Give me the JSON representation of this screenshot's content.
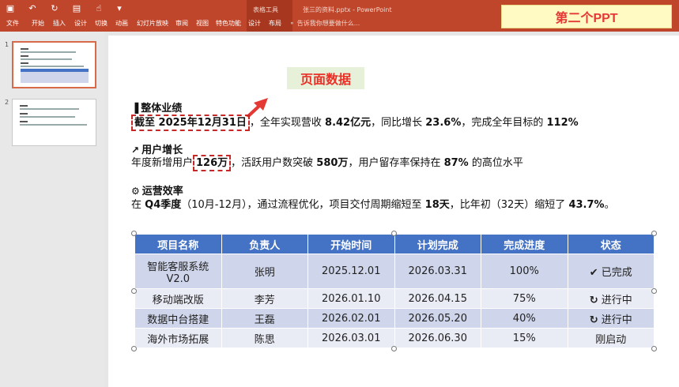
{
  "ribbon": {
    "quick_access": [
      {
        "icon": "save-icon",
        "glyph": "▣"
      },
      {
        "icon": "undo-icon",
        "glyph": "↶"
      },
      {
        "icon": "redo-icon",
        "glyph": "↻"
      },
      {
        "icon": "presentation-icon",
        "glyph": "▤"
      },
      {
        "icon": "touch-mode-icon",
        "glyph": "☝"
      },
      {
        "icon": "customize-icon",
        "glyph": "▾"
      }
    ],
    "tabs": [
      "文件",
      "开始",
      "插入",
      "设计",
      "切换",
      "动画",
      "幻灯片放映",
      "审阅",
      "视图",
      "特色功能",
      "设计",
      "布局"
    ],
    "context_group": "表格工具",
    "document_title": "张三的资料.pptx - PowerPoint",
    "tell_me": "告诉我你想要做什么...",
    "banner": "第二个PPT"
  },
  "thumbnails": {
    "numbers": [
      "1",
      "2"
    ]
  },
  "slide": {
    "callout": "页面数据",
    "sections": [
      {
        "icon": "bar-chart-icon",
        "glyph": "▐",
        "title": "整体业绩",
        "highlight": "截至 2025年12月31日",
        "text_a": "，全年实现营收 ",
        "bold_a": "8.42亿元",
        "text_b": "，同比增长 ",
        "bold_b": "23.6%",
        "text_c": "，完成全年目标的 ",
        "bold_c": "112%"
      },
      {
        "icon": "trend-chart-icon",
        "glyph": "↗",
        "title": "用户增长",
        "prefix": "年度新增用户",
        "highlight": "126万",
        "text_a": "，活跃用户数突破 ",
        "bold_a": "580万",
        "text_b": "，用户留存率保持在 ",
        "bold_b": "87%",
        "text_c": " 的高位水平"
      },
      {
        "icon": "gear-icon",
        "glyph": "⚙",
        "title": "运营效率",
        "text_pre": "在 ",
        "bold_a": "Q4季度",
        "text_a": "（10月-12月），通过流程优化，项目交付周期缩短至 ",
        "bold_b": "18天",
        "text_b": "，比年初（32天）缩短了 ",
        "bold_c": "43.7%",
        "text_c": "。"
      }
    ],
    "table": {
      "headers": [
        "项目名称",
        "负责人",
        "开始时间",
        "计划完成",
        "完成进度",
        "状态"
      ],
      "rows": [
        [
          "智能客服系统V2.0",
          "张明",
          "2025.12.01",
          "2026.03.31",
          "100%",
          "已完成"
        ],
        [
          "移动端改版",
          "李芳",
          "2026.01.10",
          "2026.04.15",
          "75%",
          "进行中"
        ],
        [
          "数据中台搭建",
          "王磊",
          "2026.02.01",
          "2026.05.20",
          "40%",
          "进行中"
        ],
        [
          "海外市场拓展",
          "陈思",
          "2026.03.01",
          "2026.06.30",
          "15%",
          "刚启动"
        ]
      ],
      "status_icons": [
        "check-icon",
        "sync-icon",
        "sync-icon",
        ""
      ],
      "status_glyphs": [
        "✔",
        "↻",
        "↻",
        ""
      ]
    }
  },
  "colors": {
    "ribbon": "#c0462b",
    "table_header": "#4472c4",
    "highlight_red": "#c62828"
  }
}
